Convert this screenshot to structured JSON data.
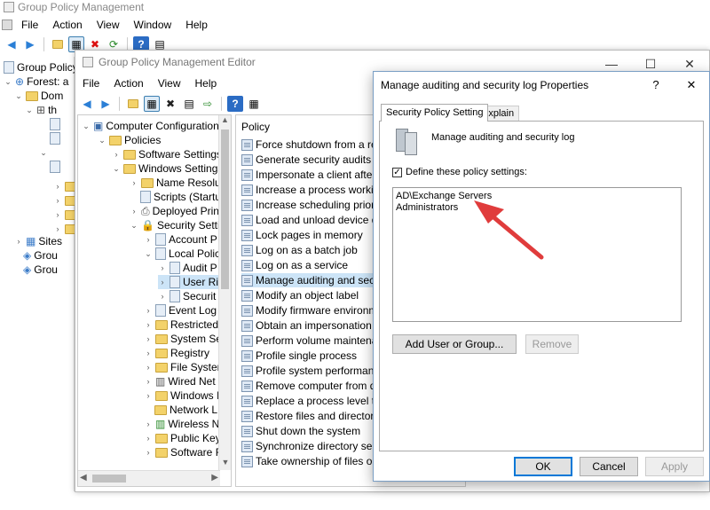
{
  "gpm": {
    "title": "Group Policy Management",
    "menu": [
      "File",
      "Action",
      "View",
      "Window",
      "Help"
    ],
    "tree": [
      "Group Policy",
      "Forest: a",
      "Dom",
      "th",
      "Sites",
      "Grou",
      "Grou"
    ]
  },
  "editor": {
    "title": "Group Policy Management Editor",
    "menu": [
      "File",
      "Action",
      "View",
      "Help"
    ],
    "tree": [
      "Computer Configuration",
      "Policies",
      "Software Settings",
      "Windows Settings",
      "Name Resolut",
      "Scripts (Startu",
      "Deployed Prin",
      "Security Settin",
      "Account P",
      "Local Polic",
      "Audit P",
      "User Ri",
      "Securit",
      "Event Log",
      "Restricted",
      "System Se",
      "Registry",
      "File Systen",
      "Wired Net",
      "Windows I",
      "Network L",
      "Wireless N",
      "Public Key",
      "Software R"
    ],
    "policy_header": "Policy",
    "policies": [
      "Force shutdown from a rem",
      "Generate security audits",
      "Impersonate a client after au",
      "Increase a process working s",
      "Increase scheduling priority",
      "Load and unload device drive",
      "Lock pages in memory",
      "Log on as a batch job",
      "Log on as a service",
      "Manage auditing and securi",
      "Modify an object label",
      "Modify firmware environme",
      "Obtain an impersonation tol",
      "Perform volume maintenan",
      "Profile single process",
      "Profile system performance",
      "Remove computer from doc",
      "Replace a process level toke",
      "Restore files and directories",
      "Shut down the system",
      "Synchronize directory servic",
      "Take ownership of files or ot"
    ]
  },
  "dialog": {
    "title": "Manage auditing and security log Properties",
    "help": "?",
    "close": "✕",
    "tabs": [
      "Security Policy Setting",
      "Explain"
    ],
    "policy_name": "Manage auditing and security log",
    "checkbox_label": "Define these policy settings:",
    "entries": [
      "AD\\Exchange Servers",
      "Administrators"
    ],
    "add_button": "Add User or Group...",
    "remove_button": "Remove",
    "ok": "OK",
    "cancel": "Cancel",
    "apply": "Apply",
    "accent": "#e03c3c"
  }
}
